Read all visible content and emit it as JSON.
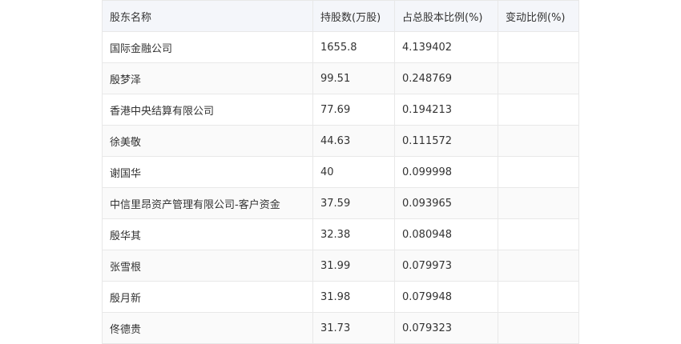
{
  "table": {
    "headers": [
      "股东名称",
      "持股数(万股)",
      "占总股本比例(%)",
      "变动比例(%)"
    ],
    "rows": [
      [
        "国际金融公司",
        "1655.8",
        "4.139402",
        ""
      ],
      [
        "殷梦泽",
        "99.51",
        "0.248769",
        ""
      ],
      [
        "香港中央结算有限公司",
        "77.69",
        "0.194213",
        ""
      ],
      [
        "徐美敬",
        "44.63",
        "0.111572",
        ""
      ],
      [
        "谢国华",
        "40",
        "0.099998",
        ""
      ],
      [
        "中信里昂资产管理有限公司-客户资金",
        "37.59",
        "0.093965",
        ""
      ],
      [
        "殷华其",
        "32.38",
        "0.080948",
        ""
      ],
      [
        "张雪根",
        "31.99",
        "0.079973",
        ""
      ],
      [
        "殷月新",
        "31.98",
        "0.079948",
        ""
      ],
      [
        "佟德贵",
        "31.73",
        "0.079323",
        ""
      ]
    ]
  }
}
